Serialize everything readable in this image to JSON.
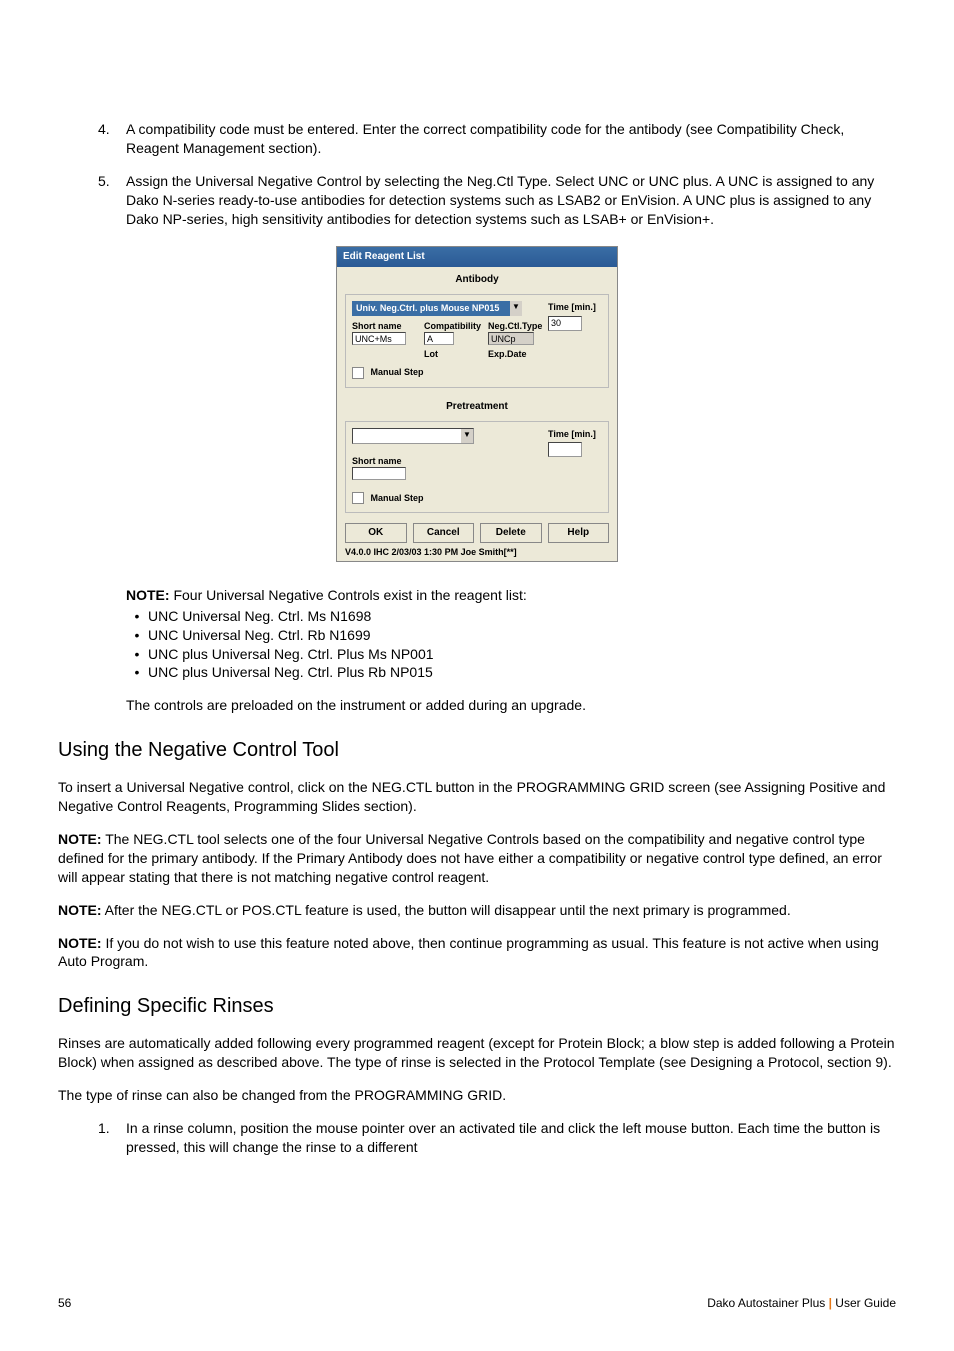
{
  "list_items": {
    "n4": {
      "num": "4.",
      "text": "A compatibility code must be entered.  Enter the correct compatibility code for the antibody (see Compatibility Check, Reagent Management section)."
    },
    "n5": {
      "num": "5.",
      "text": "Assign the Universal Negative Control by selecting the Neg.Ctl Type. Select UNC or UNC plus. A UNC is assigned to any Dako N-series ready-to-use antibodies for detection systems such as LSAB2 or EnVision.  A UNC plus is assigned to any Dako NP-series, high sensitivity antibodies for detection systems such as LSAB+ or EnVision+."
    }
  },
  "dialog": {
    "title": "Edit Reagent List",
    "antibody_head": "Antibody",
    "combo_text": "Univ. Neg.Ctrl. plus Mouse NP015",
    "time_label": "Time [min.]",
    "time_value": "30",
    "short_name_label": "Short name",
    "short_name_value": "UNC+Ms",
    "compat_label": "Compatibility",
    "compat_value": "A",
    "neg_type_label": "Neg.Ctl.Type",
    "neg_type_value": "UNCp",
    "lot_label": "Lot",
    "exp_label": "Exp.Date",
    "manual_step": "Manual Step",
    "pretreat_head": "Pretreatment",
    "buttons": {
      "ok": "OK",
      "cancel": "Cancel",
      "delete": "Delete",
      "help": "Help"
    },
    "status": "V4.0.0   IHC   2/03/03   1:30 PM   Joe Smith[**]"
  },
  "note1": {
    "label": "NOTE:",
    "lead": "  Four Universal Negative Controls exist in the reagent list:",
    "bullets": [
      "UNC Universal Neg. Ctrl. Ms N1698",
      "UNC Universal Neg. Ctrl. Rb N1699",
      "UNC plus Universal Neg. Ctrl. Plus Ms NP001",
      "UNC plus Universal Neg. Ctrl. Plus Rb NP015"
    ],
    "trailer": "The controls are preloaded on the instrument or added during an upgrade."
  },
  "section1": {
    "heading": "Using the Negative Control Tool",
    "p1": "To insert a Universal Negative control, click on the NEG.CTL button in the PROGRAMMING GRID screen (see Assigning Positive and Negative Control Reagents, Programming Slides section).",
    "note_a": {
      "label": "NOTE:",
      "text": "  The NEG.CTL tool selects one of the four Universal Negative Controls based on the compatibility and negative control type defined for the primary antibody. If the Primary Antibody does not have either a compatibility or negative control type defined, an error will appear stating that there is not matching negative control reagent."
    },
    "note_b": {
      "label": "NOTE:",
      "text": "  After the NEG.CTL or POS.CTL feature is used, the button will disappear until the next primary is programmed."
    },
    "note_c": {
      "label": "NOTE:",
      "text": "  If you do not wish to use this feature noted above, then continue programming as usual. This feature is not active when using Auto Program."
    }
  },
  "section2": {
    "heading": "Defining Specific Rinses",
    "p1": "Rinses are automatically added following every programmed reagent (except for Protein Block; a blow step is added following a Protein Block) when assigned as described above. The type of rinse is selected in the Protocol Template (see Designing a Protocol, section 9).",
    "p2": "The type of rinse can also be changed from the PROGRAMMING GRID.",
    "step1": {
      "num": "1.",
      "text": "In a rinse column, position the mouse pointer over an activated tile and click the left mouse button. Each time the button is pressed, this will change the rinse to a different"
    }
  },
  "footer": {
    "page": "56",
    "right_plain": "Dako Autostainer Plus",
    "right_sep": " | ",
    "right_tail": "User Guide"
  }
}
